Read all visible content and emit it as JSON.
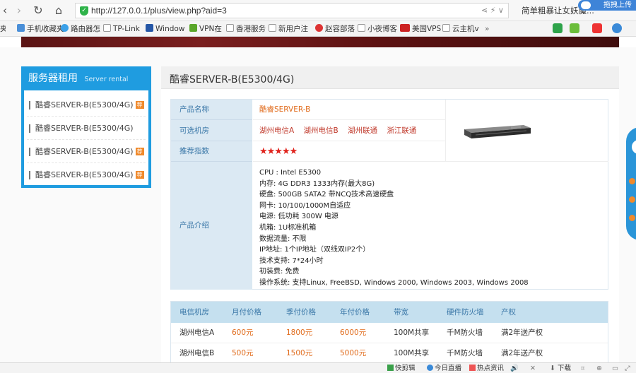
{
  "browser": {
    "url": "http://127.0.0.1/plus/view.php?aid=3",
    "search_text": "简单粗暴让女妖魔...",
    "upload_label": "拖拽上传",
    "bookmarks": [
      "手机收藏夹",
      "路由器怎",
      "TP-Link",
      "Window",
      "VPN在",
      "香港服务",
      "新用户注",
      "赵容部落",
      "小夜博客",
      "美国VPS",
      "云主机v"
    ],
    "bookmark_overflow": "»"
  },
  "sidebar": {
    "title": "服务器租用",
    "subtitle": "Server rental",
    "items": [
      {
        "label": "酷睿SERVER-B(E5300/4G)",
        "tag": "荐"
      },
      {
        "label": "酷睿SERVER-B(E5300/4G)",
        "tag": ""
      },
      {
        "label": "酷睿SERVER-B(E5300/4G)",
        "tag": "荐"
      },
      {
        "label": "酷睿SERVER-B(E5300/4G)",
        "tag": "荐"
      }
    ]
  },
  "product": {
    "title": "酷睿SERVER-B(E5300/4G)",
    "name_label": "产品名称",
    "name_value": "酷睿SERVER-B",
    "rooms_label": "可选机房",
    "rooms": [
      "湖州电信A",
      "湖州电信B",
      "湖州联通",
      "浙江联通"
    ],
    "rating_label": "推荐指数",
    "rating": "★★★★★",
    "desc_label": "产品介绍",
    "desc_lines": [
      "CPU : Intel E5300",
      "内存: 4G DDR3 1333内存(最大8G)",
      "硬盘: 500GB SATA2 带NCQ技术高速硬盘",
      "网卡: 10/100/1000M自适应",
      "电源: 低功耗 300W 电源",
      "机箱: 1U标准机箱",
      "数据流量: 不限",
      "IP地址: 1个IP地址（双线双IP2个）",
      "技术支持: 7*24小时",
      "初装费: 免费",
      "操作系统: 支持Linux, FreeBSD, Windows 2000, Windows 2003, Windows 2008"
    ]
  },
  "pricing": {
    "headers": [
      "电信机房",
      "月付价格",
      "季付价格",
      "年付价格",
      "带宽",
      "硬件防火墙",
      "产权"
    ],
    "rows": [
      [
        "湖州电信A",
        "600元",
        "1800元",
        "6000元",
        "100M共享",
        "千M防火墙",
        "满2年送产权"
      ],
      [
        "湖州电信B",
        "500元",
        "1500元",
        "5000元",
        "100M共享",
        "千M防火墙",
        "满2年送产权"
      ]
    ]
  },
  "statusbar": {
    "items": [
      "快剪辑",
      "今日直播",
      "热点资讯",
      "下载"
    ]
  },
  "colors": {
    "accent": "#1f9ce0",
    "label_bg": "#dbe9f3",
    "price": "#e06a1a",
    "room": "#c0392b"
  }
}
